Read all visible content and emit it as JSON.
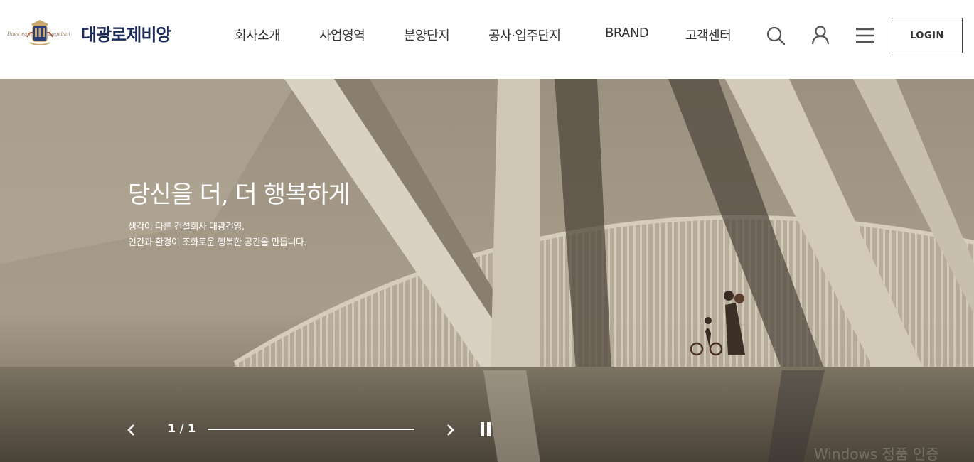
{
  "header": {
    "logo": {
      "emblem_left_script": "Daekwang",
      "emblem_right_script": "Logeban",
      "brand": "대광로제비앙"
    },
    "nav": [
      "회사소개",
      "사업영역",
      "분양단지",
      "공사·입주단지",
      "BRAND",
      "고객센터"
    ],
    "login_label": "LOGIN"
  },
  "hero": {
    "title": "당신을 더, 더 행복하게",
    "subtitle_line1": "생각이 다른 건설회사 대광건영,",
    "subtitle_line2": "인간과 환경이 조화로운 행복한 공간을 만듭니다.",
    "slide_counter": "1 / 1",
    "progress": 1.0
  },
  "watermark": "Windows 정품 인증",
  "colors": {
    "brand_navy": "#1c2b5a",
    "nav_text": "#333333",
    "hero_tone": "#8c8170"
  }
}
